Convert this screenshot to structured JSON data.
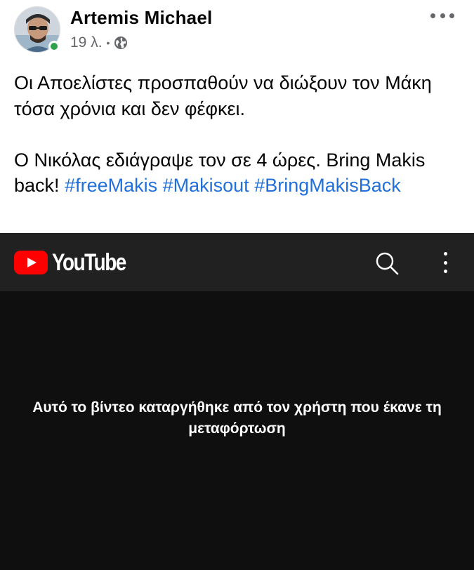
{
  "post": {
    "author": "Artemis Michael",
    "time": "19 λ.",
    "separator": "•",
    "audience_icon": "globe-icon",
    "more_icon": "more-horizontal-icon",
    "online": true,
    "text": {
      "paragraph1": "Οι Αποελίστες προσπαθούν να διώξουν τον Μάκη τόσα χρόνια και δεν φέφκει.",
      "paragraph2_prefix": "Ο Νικόλας εδιάγραψε τον σε 4 ώρες. Bring Makis back!",
      "hashtags": [
        "#freeMakis",
        "#Makisout",
        "#BringMakisBack"
      ]
    }
  },
  "youtube": {
    "logo_text": "YouTube",
    "removed_message": "Αυτό το βίντεο καταργήθηκε από τον χρήστη που έκανε τη μεταφόρτωση",
    "colors": {
      "brand_red": "#ff0000",
      "bar_bg": "#212121",
      "player_bg": "#0f0f0f"
    }
  },
  "colors": {
    "hashtag": "#216fdb",
    "meta_gray": "#65676b",
    "online_green": "#31a24c"
  }
}
